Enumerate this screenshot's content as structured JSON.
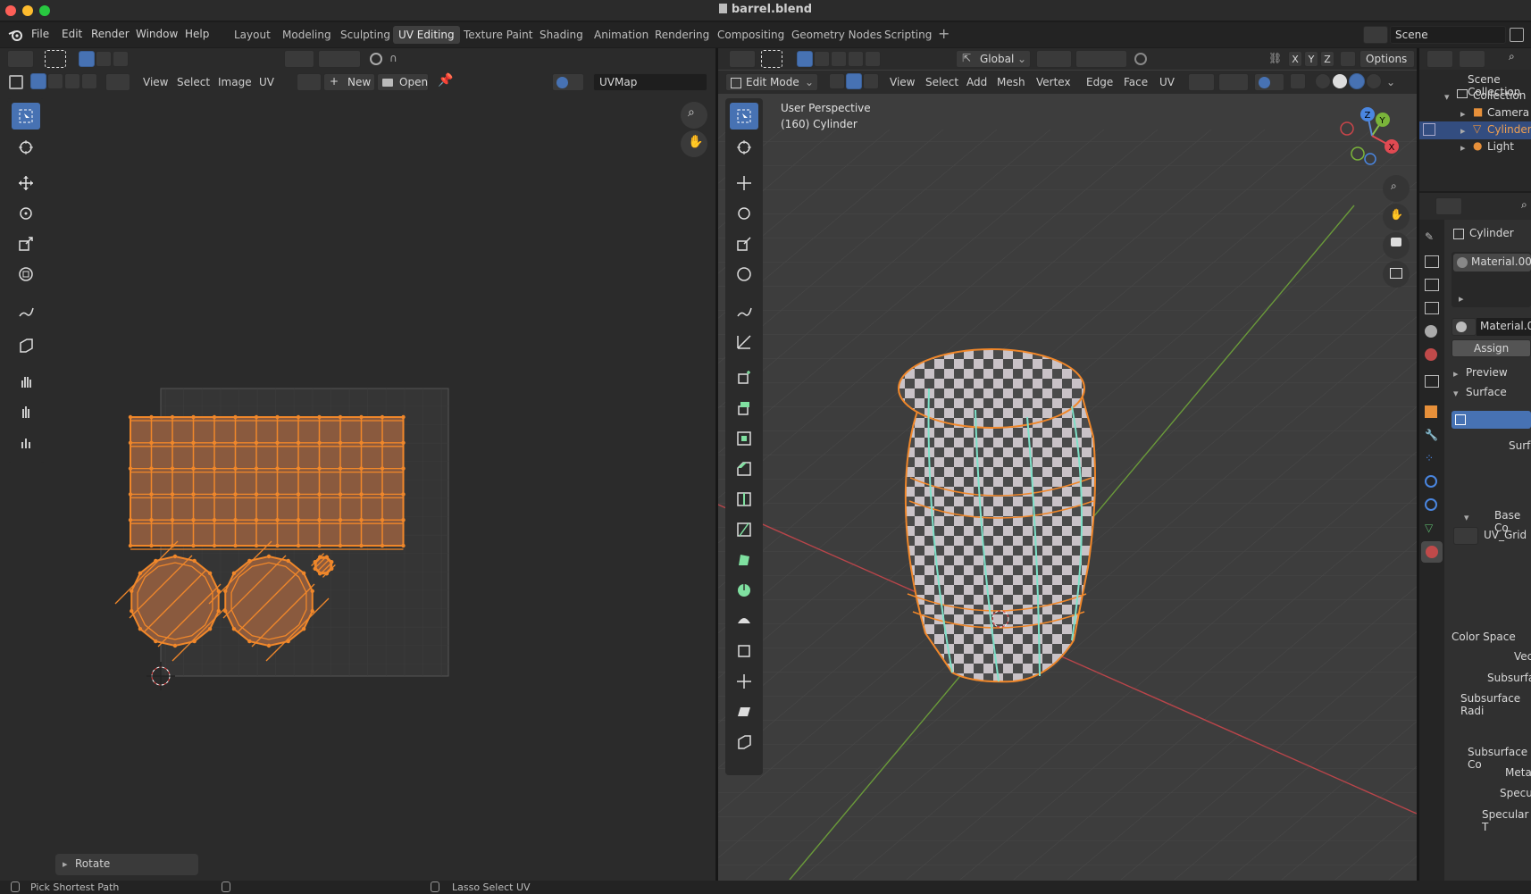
{
  "window": {
    "title": "barrel.blend"
  },
  "menu": [
    "File",
    "Edit",
    "Render",
    "Window",
    "Help"
  ],
  "workspaces": [
    "Layout",
    "Modeling",
    "Sculpting",
    "UV Editing",
    "Texture Paint",
    "Shading",
    "Animation",
    "Rendering",
    "Compositing",
    "Geometry Nodes",
    "Scripting"
  ],
  "active_workspace": "UV Editing",
  "scene": {
    "name": "Scene"
  },
  "uv_editor": {
    "menus": [
      "View",
      "Select",
      "Image",
      "UV"
    ],
    "new_label": "New",
    "open_label": "Open",
    "uvmap": "UVMap",
    "operator_panel": "Rotate"
  },
  "viewport": {
    "mode": "Edit Mode",
    "menus": [
      "View",
      "Select",
      "Add",
      "Mesh",
      "Vertex",
      "Edge",
      "Face",
      "UV"
    ],
    "orientation": "Global",
    "options_label": "Options",
    "axes": [
      "X",
      "Y",
      "Z"
    ],
    "overlay_line1": "User Perspective",
    "overlay_line2": "(160) Cylinder",
    "gizmo": {
      "z": "Z",
      "y": "Y",
      "x": "X"
    }
  },
  "outliner": {
    "root": "Scene Collection",
    "collection": "Collection",
    "items": [
      "Camera",
      "Cylinder",
      "Light"
    ],
    "selected": "Cylinder"
  },
  "properties": {
    "object": "Cylinder",
    "material_slot": "Material.00",
    "material_name": "Material.0",
    "assign_label": "Assign",
    "sections": [
      "Preview",
      "Surface"
    ],
    "fields": [
      "Surfa",
      "Base Co",
      "UV_Grid",
      "Color Space",
      "Vect",
      "Subsurfa",
      "Subsurface Radi",
      "Subsurface Co",
      "Metal",
      "Specu",
      "Specular T"
    ]
  },
  "statusbar": {
    "left": "Pick Shortest Path",
    "middle": "Lasso Select UV"
  },
  "colors": {
    "accent": "#4772b3",
    "selection": "#f0872a",
    "mesh_fill": "#8a5a3e",
    "bg": "#303030",
    "header": "#2b2b2b"
  }
}
